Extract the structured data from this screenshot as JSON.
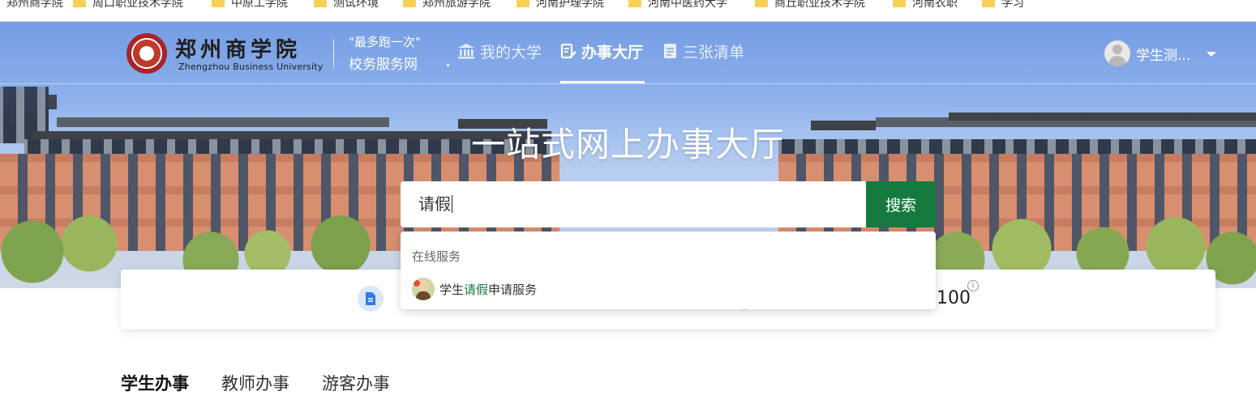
{
  "bookmarks": [
    {
      "label": "郑州商学院"
    },
    {
      "label": "周口职业技术学院"
    },
    {
      "label": "中原工学院"
    },
    {
      "label": "测试环境"
    },
    {
      "label": "郑州旅游学院"
    },
    {
      "label": "河南护理学院"
    },
    {
      "label": "河南中医药大学"
    },
    {
      "label": "商丘职业技术学院"
    },
    {
      "label": "河南农职"
    },
    {
      "label": "学习"
    }
  ],
  "header": {
    "logo_cn": "郑州商学院",
    "logo_en": "Zhengzhou Business University",
    "slogan_line1": "\"最多跑一次\"",
    "slogan_line2": "校务服务网",
    "nav": [
      {
        "label": "我的大学",
        "icon": "bank-icon",
        "active": false
      },
      {
        "label": "办事大厅",
        "icon": "edit-doc-icon",
        "active": true
      },
      {
        "label": "三张清单",
        "icon": "list-doc-icon",
        "active": false
      }
    ],
    "user_name": "学生测..."
  },
  "hero": {
    "title": "一站式网上办事大厅"
  },
  "search": {
    "value": "请假",
    "button_label": "搜索"
  },
  "dropdown": {
    "section_title": "在线服务",
    "items": [
      {
        "prefix": "学生",
        "highlight": "请假",
        "suffix": "申请服务"
      }
    ]
  },
  "stats": {
    "value": "100"
  },
  "tabs": [
    {
      "label": "学生办事",
      "active": true
    },
    {
      "label": "教师办事",
      "active": false
    },
    {
      "label": "游客办事",
      "active": false
    }
  ],
  "colors": {
    "accent_green": "#167a3f",
    "hero_sky": "#7ea6ea"
  }
}
